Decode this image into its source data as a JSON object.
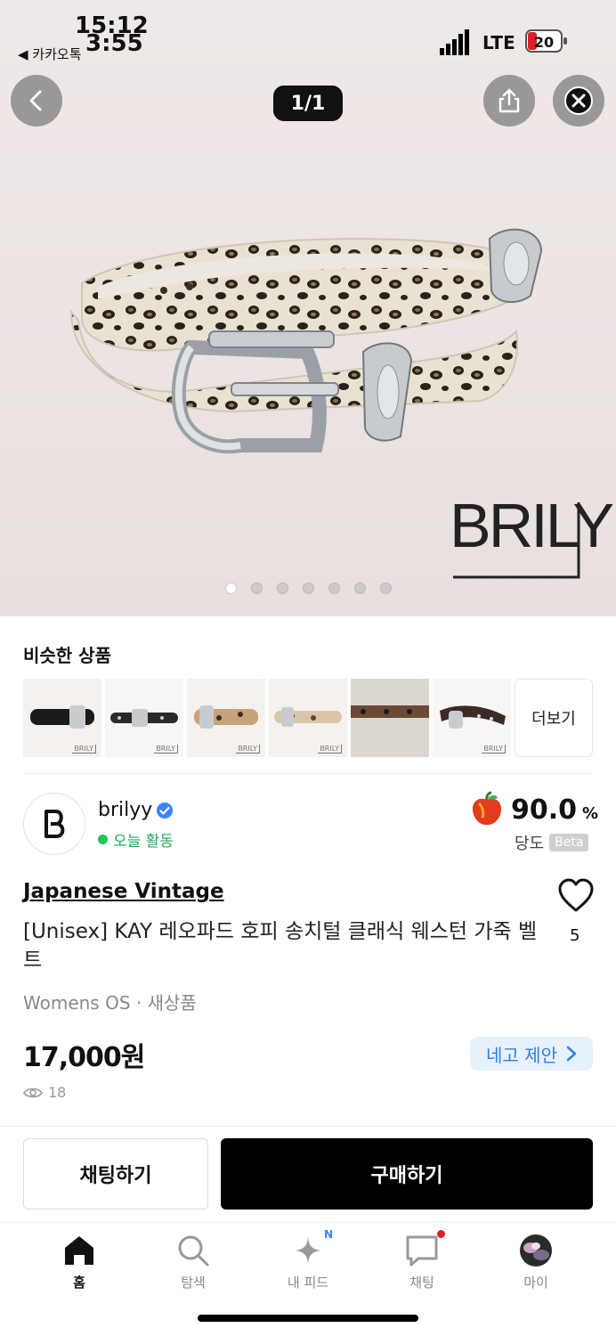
{
  "status_bar": {
    "time_primary": "15:12",
    "time_secondary": "3:55",
    "back_app": "◀ 카카오톡",
    "network": "LTE",
    "battery": "20"
  },
  "viewer": {
    "counter": "1/1",
    "brand_watermark": "BRILY",
    "image_dots": 7,
    "active_dot": 0
  },
  "icons": {
    "back": "back-arrow-icon",
    "share": "share-icon",
    "close": "close-icon"
  },
  "similar": {
    "title": "비슷한 상품",
    "more_label": "더보기",
    "items": [
      {
        "color": "#1b1b1b"
      },
      {
        "color": "#2a2a2a"
      },
      {
        "color": "#c8a27a"
      },
      {
        "color": "#d7c6a8"
      },
      {
        "color": "#6b4a36"
      },
      {
        "color": "#3b2a26"
      }
    ]
  },
  "seller": {
    "name": "brilyy",
    "status": "오늘 활동",
    "score": "90.0",
    "score_unit": "%",
    "score_label": "당도",
    "beta": "Beta"
  },
  "product": {
    "shop": "Japanese Vintage",
    "title": "[Unisex] KAY 레오파드 호피 송치털 클래식 웨스턴 가죽 벨트",
    "likes": "5",
    "meta": "Womens OS · 새상품",
    "price": "17,000원",
    "negotiate": "네고 제안",
    "views": "18"
  },
  "actions": {
    "chat": "채팅하기",
    "buy": "구매하기"
  },
  "nav": [
    {
      "label": "홈",
      "icon": "home-icon",
      "active": true
    },
    {
      "label": "탐색",
      "icon": "search-icon"
    },
    {
      "label": "내 피드",
      "icon": "feed-sparkle-icon",
      "badge": "N"
    },
    {
      "label": "채팅",
      "icon": "chat-icon"
    },
    {
      "label": "마이",
      "icon": "profile-avatar-icon"
    }
  ],
  "colors": {
    "accent_blue": "#2d7fe0",
    "active_green": "#22c55e",
    "badge_red": "#e11d2a"
  }
}
